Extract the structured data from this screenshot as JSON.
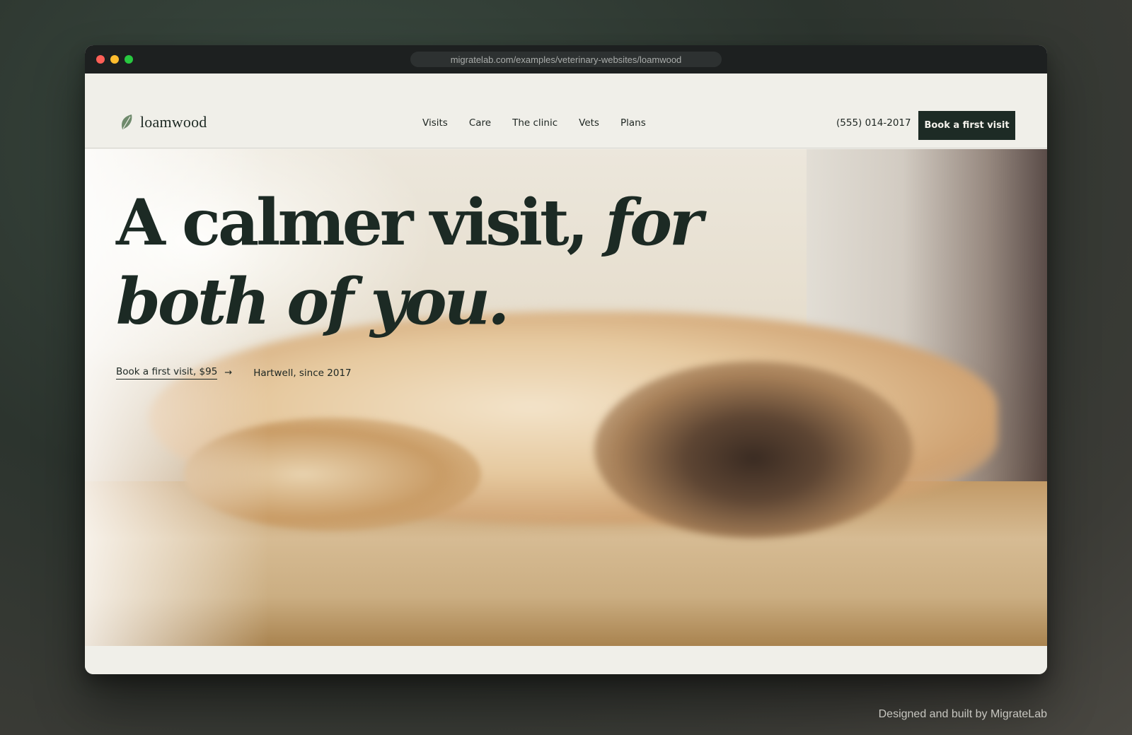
{
  "browser": {
    "url": "migratelab.com/examples/veterinary-websites/loamwood"
  },
  "nav": {
    "brand": "loamwood",
    "links": [
      "Visits",
      "Care",
      "The clinic",
      "Vets",
      "Plans"
    ],
    "phone": "(555) 014-2017",
    "cta_label": "Book a first visit"
  },
  "hero": {
    "headline_regular": "A calmer visit, ",
    "headline_italic": "for both of you.",
    "cta_label": "Book a first visit, $95",
    "arrow": "→",
    "location": "Hartwell, since 2017"
  },
  "footer": {
    "credit": "Designed and built by MigrateLab"
  },
  "colors": {
    "brand_dark": "#1d2b25",
    "page_bg": "#f0efe9",
    "leaf": "#6f8a6c"
  },
  "icons": {
    "logo": "leaf-icon",
    "cta_arrow": "arrow-right-icon"
  }
}
